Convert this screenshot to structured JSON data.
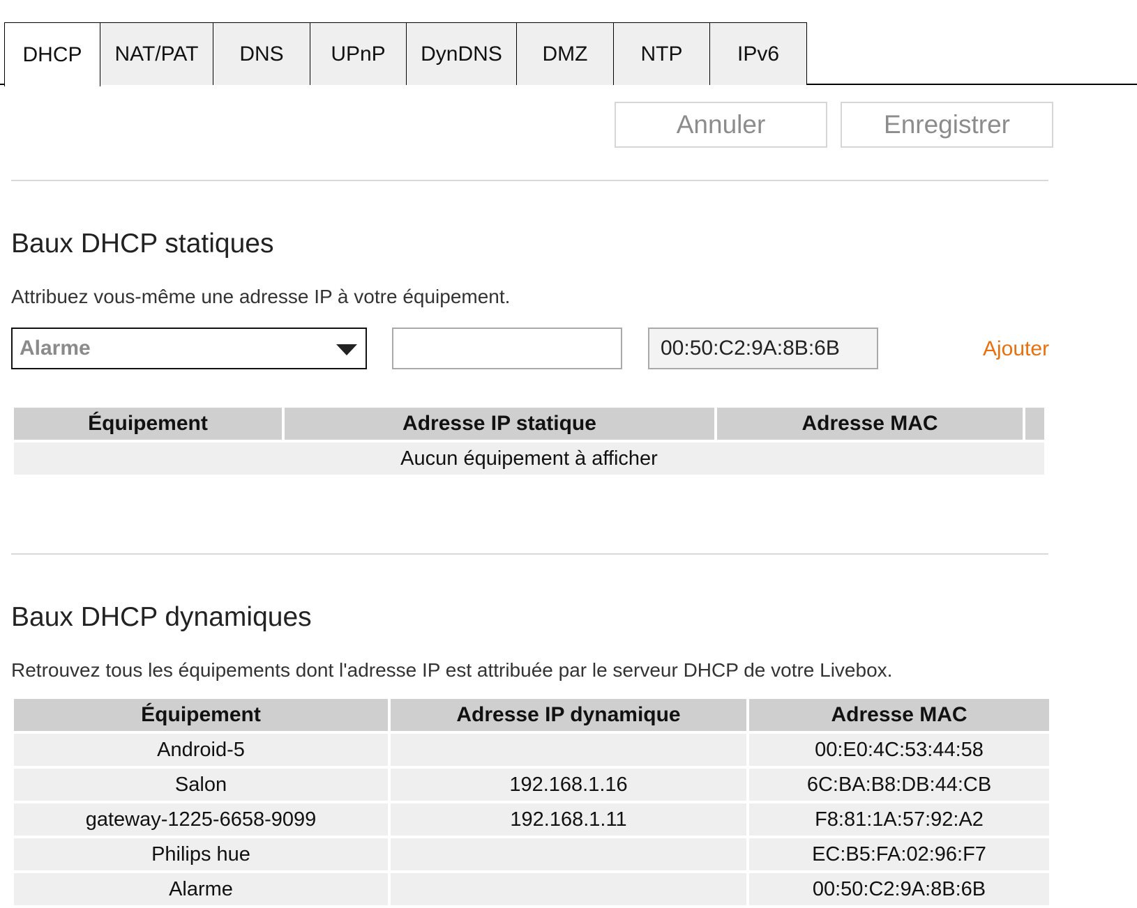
{
  "tabs": [
    {
      "label": "DHCP",
      "active": true
    },
    {
      "label": "NAT/PAT",
      "active": false
    },
    {
      "label": "DNS",
      "active": false
    },
    {
      "label": "UPnP",
      "active": false
    },
    {
      "label": "DynDNS",
      "active": false
    },
    {
      "label": "DMZ",
      "active": false
    },
    {
      "label": "NTP",
      "active": false
    },
    {
      "label": "IPv6",
      "active": false
    }
  ],
  "actions": {
    "cancel_label": "Annuler",
    "save_label": "Enregistrer"
  },
  "static": {
    "title": "Baux DHCP statiques",
    "description": "Attribuez vous-même une adresse IP à votre équipement.",
    "device_select_value": "Alarme",
    "ip_input_value": "",
    "mac_input_value": "00:50:C2:9A:8B:6B",
    "add_label": "Ajouter",
    "columns": [
      "Équipement",
      "Adresse IP statique",
      "Adresse MAC",
      ""
    ],
    "empty_message": "Aucun équipement à afficher"
  },
  "dynamic": {
    "title": "Baux DHCP dynamiques",
    "description": "Retrouvez tous les équipements dont l'adresse IP est attribuée par le serveur DHCP de votre Livebox.",
    "columns": [
      "Équipement",
      "Adresse IP dynamique",
      "Adresse MAC"
    ],
    "rows": [
      [
        "Android-5",
        "",
        "00:E0:4C:53:44:58"
      ],
      [
        "Salon",
        "192.168.1.16",
        "6C:BA:B8:DB:44:CB"
      ],
      [
        "gateway-1225-6658-9099",
        "192.168.1.11",
        "F8:81:1A:57:92:A2"
      ],
      [
        "Philips hue",
        "",
        "EC:B5:FA:02:96:F7"
      ],
      [
        "Alarme",
        "",
        "00:50:C2:9A:8B:6B"
      ]
    ]
  },
  "colors": {
    "accent": "#e8700d",
    "header_bg": "#cfcfcf",
    "row_bg": "#efefef"
  }
}
